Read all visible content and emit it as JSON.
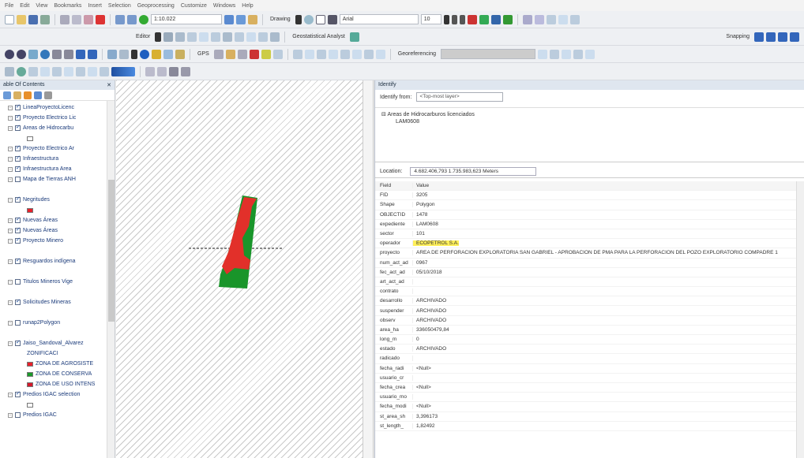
{
  "menu": [
    "File",
    "Edit",
    "View",
    "Bookmarks",
    "Insert",
    "Selection",
    "Geoprocessing",
    "Customize",
    "Windows",
    "Help"
  ],
  "toolbar": {
    "scale": "1:10.022",
    "drawing_label": "Drawing",
    "font": "Arial",
    "font_size": "10",
    "editor_label": "Editor",
    "geostatistical_label": "Geostatistical Analyst",
    "snapping_label": "Snapping",
    "gps_label": "GPS",
    "georeferencing_label": "Georeferencing"
  },
  "toc": {
    "title": "able Of Contents",
    "items": [
      {
        "label": "LineaProyectoLicenc",
        "checked": true,
        "swatch": ""
      },
      {
        "label": "Proyecto Electrico Lic",
        "checked": true,
        "swatch": ""
      },
      {
        "label": "Areas de Hidrocarbu",
        "checked": true,
        "swatch": ""
      },
      {
        "label": "",
        "checked": false,
        "swatch": "#ffffff"
      },
      {
        "label": "Proyecto Electrico Ar",
        "checked": true,
        "swatch": ""
      },
      {
        "label": "Infraestructura",
        "checked": true,
        "swatch": ""
      },
      {
        "label": "Infraestructura Area",
        "checked": true,
        "swatch": ""
      },
      {
        "label": "Mapa de Tierras ANH",
        "checked": false,
        "swatch": ""
      },
      {
        "label": "",
        "checked": false,
        "swatch": ""
      },
      {
        "label": "Negritudes",
        "checked": true,
        "swatch": ""
      },
      {
        "label": "",
        "checked": false,
        "swatch": "#e8202a"
      },
      {
        "label": "Nuevas Áreas",
        "checked": true,
        "swatch": ""
      },
      {
        "label": "Nuevas Áreas",
        "checked": true,
        "swatch": ""
      },
      {
        "label": "Proyecto Minero",
        "checked": true,
        "swatch": ""
      },
      {
        "label": "",
        "checked": false,
        "swatch": ""
      },
      {
        "label": "Resguardos indígena",
        "checked": true,
        "swatch": ""
      },
      {
        "label": "",
        "checked": false,
        "swatch": ""
      },
      {
        "label": "Titulos Mineros Vige",
        "checked": false,
        "swatch": ""
      },
      {
        "label": "",
        "checked": false,
        "swatch": ""
      },
      {
        "label": "Solicitudes Mineras",
        "checked": true,
        "swatch": ""
      },
      {
        "label": "",
        "checked": false,
        "swatch": ""
      },
      {
        "label": "runap2Polygon",
        "checked": false,
        "swatch": ""
      },
      {
        "label": "",
        "checked": false,
        "swatch": ""
      },
      {
        "label": "Jaiso_Sandoval_Alvarez",
        "checked": true,
        "swatch": ""
      },
      {
        "label": "ZONIFICACI",
        "checked": false,
        "swatch": ""
      },
      {
        "label": "ZONA DE AGROSISTE",
        "checked": false,
        "swatch": "#e8202a"
      },
      {
        "label": "ZONA DE CONSERVA",
        "checked": false,
        "swatch": "#1a9a2a"
      },
      {
        "label": "ZONA DE USO INTENS",
        "checked": false,
        "swatch": "#d4182a"
      },
      {
        "label": "Predios IGAC selection",
        "checked": true,
        "swatch": ""
      },
      {
        "label": "",
        "checked": false,
        "swatch": "#ffffff"
      },
      {
        "label": "Predios IGAC",
        "checked": false,
        "swatch": ""
      }
    ]
  },
  "identify": {
    "title": "Identify",
    "from_label": "Identify from:",
    "from_value": "<Top-most layer>",
    "tree_root": "Areas de Hidrocarburos licenciados",
    "tree_child": "LAM0608",
    "location_label": "Location:",
    "location_value": "4.682.406,793 1.735.983,623 Meters",
    "attr_header": {
      "field": "Field",
      "value": "Value"
    },
    "attributes": [
      {
        "field": "FID",
        "value": "3205"
      },
      {
        "field": "Shape",
        "value": "Polygon"
      },
      {
        "field": "OBJECTID",
        "value": "1478"
      },
      {
        "field": "expediente",
        "value": "LAM0608"
      },
      {
        "field": "sector",
        "value": "101"
      },
      {
        "field": "operador",
        "value": "ECOPETROL S.A.",
        "highlight": true
      },
      {
        "field": "proyecto",
        "value": "AREA DE PERFORACION EXPLORATORIA SAN GABRIEL - APROBACION DE PMA PARA LA PERFORACION DEL POZO EXPLORATORIO COMPADRE 1"
      },
      {
        "field": "num_act_ad",
        "value": "0967"
      },
      {
        "field": "fec_act_ad",
        "value": "05/10/2018"
      },
      {
        "field": "art_act_ad",
        "value": ""
      },
      {
        "field": "contrato",
        "value": ""
      },
      {
        "field": "desarrollo",
        "value": "ARCHIVADO"
      },
      {
        "field": "suspender",
        "value": "ARCHIVADO"
      },
      {
        "field": "observ",
        "value": "ARCHIVADO"
      },
      {
        "field": "area_ha",
        "value": "336050479,84"
      },
      {
        "field": "long_m",
        "value": "0"
      },
      {
        "field": "estado",
        "value": "ARCHIVADO"
      },
      {
        "field": "radicado",
        "value": ""
      },
      {
        "field": "fecha_radi",
        "value": "<Null>"
      },
      {
        "field": "usuario_cr",
        "value": ""
      },
      {
        "field": "fecha_crea",
        "value": "<Null>"
      },
      {
        "field": "usuario_mo",
        "value": ""
      },
      {
        "field": "fecha_modi",
        "value": "<Null>"
      },
      {
        "field": "st_area_sh",
        "value": "3,396173"
      },
      {
        "field": "st_length_",
        "value": "1,82492"
      }
    ]
  },
  "colors": {
    "zone_red": "#e2302a",
    "zone_green": "#19952a",
    "highlight": "#ffef5a"
  }
}
